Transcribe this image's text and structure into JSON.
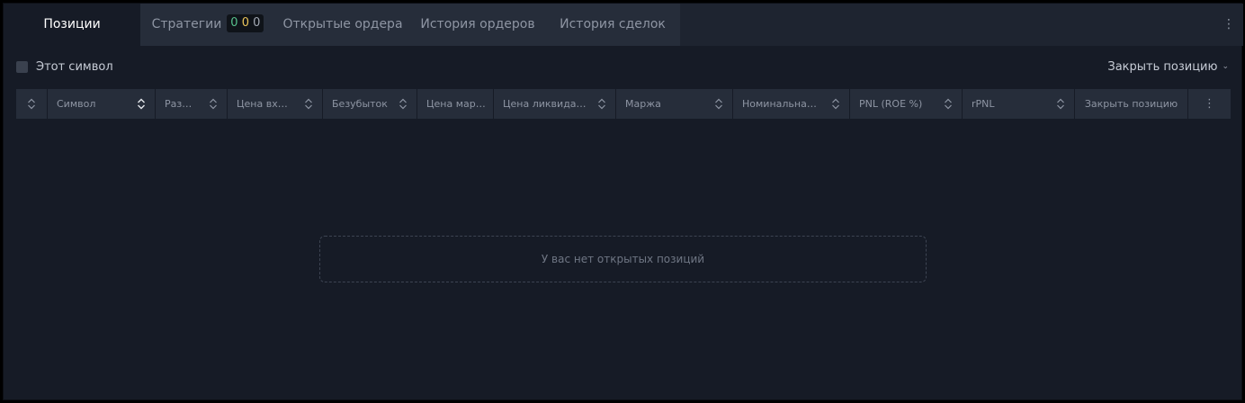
{
  "tabs": [
    {
      "label": "Позиции",
      "active": true
    },
    {
      "label": "Стратегии",
      "badge": [
        "0",
        "0",
        "0"
      ]
    },
    {
      "label": "Открытые ордера"
    },
    {
      "label": "История ордеров"
    },
    {
      "label": "История сделок"
    }
  ],
  "filter": {
    "label": "Этот символ",
    "checked": false
  },
  "close_positions": {
    "label": "Закрыть позицию"
  },
  "columns": [
    "Символ",
    "Размер",
    "Цена входа",
    "Безубыток",
    "Цена мар…",
    "Цена ликвидации",
    "Маржа",
    "Номинальная …",
    "PNL (ROE %)",
    "rPNL",
    "Закрыть позицию"
  ],
  "empty_message": "У вас нет открытых позиций",
  "icons": {
    "more": "more-vertical-icon",
    "sort": "sort-updown-icon",
    "chevron": "chevron-down-icon"
  },
  "colors": {
    "background": "#161b26",
    "tab_bar": "#1e2430",
    "header": "#262d3a",
    "badge_green": "#57c08c",
    "badge_yellow": "#e9c35a"
  }
}
